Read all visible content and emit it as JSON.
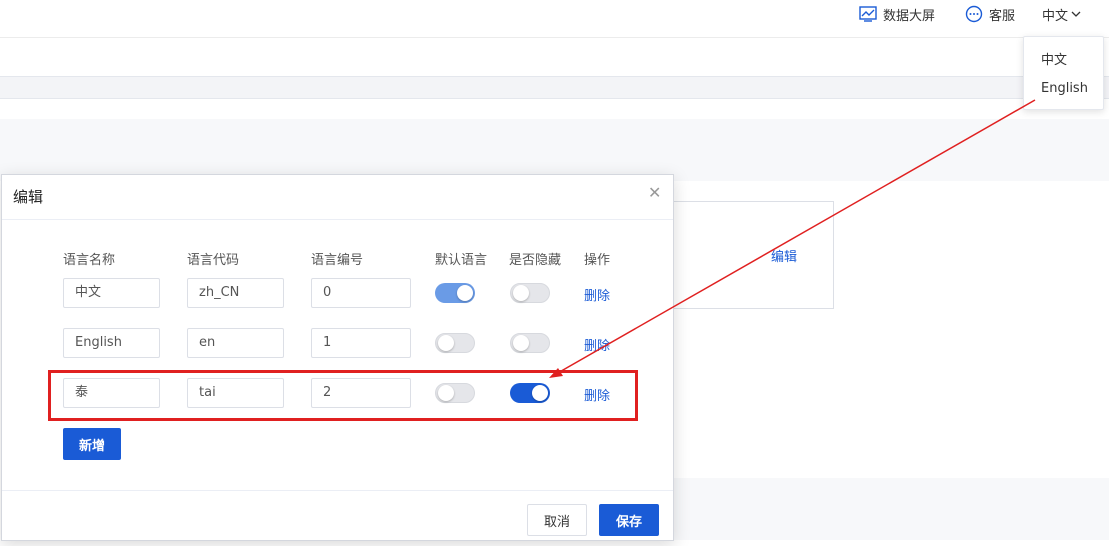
{
  "header": {
    "dashboard_label": "数据大屏",
    "service_label": "客服",
    "language_label": "中文"
  },
  "language_menu": {
    "options": [
      "中文",
      "English"
    ]
  },
  "background": {
    "edit_link": "编辑"
  },
  "modal": {
    "title": "编辑",
    "columns": [
      "语言名称",
      "语言代码",
      "语言编号",
      "默认语言",
      "是否隐藏",
      "操作"
    ],
    "rows": [
      {
        "name": "中文",
        "code": "zh_CN",
        "number": "0",
        "is_default": true,
        "is_hidden": false,
        "action": "删除"
      },
      {
        "name": "English",
        "code": "en",
        "number": "1",
        "is_default": false,
        "is_hidden": false,
        "action": "删除"
      },
      {
        "name": "泰",
        "code": "tai",
        "number": "2",
        "is_default": false,
        "is_hidden": true,
        "action": "删除"
      }
    ],
    "add_label": "新增",
    "cancel_label": "取消",
    "save_label": "保存"
  },
  "colors": {
    "primary": "#1a5bd6",
    "annotation": "#e02020"
  }
}
